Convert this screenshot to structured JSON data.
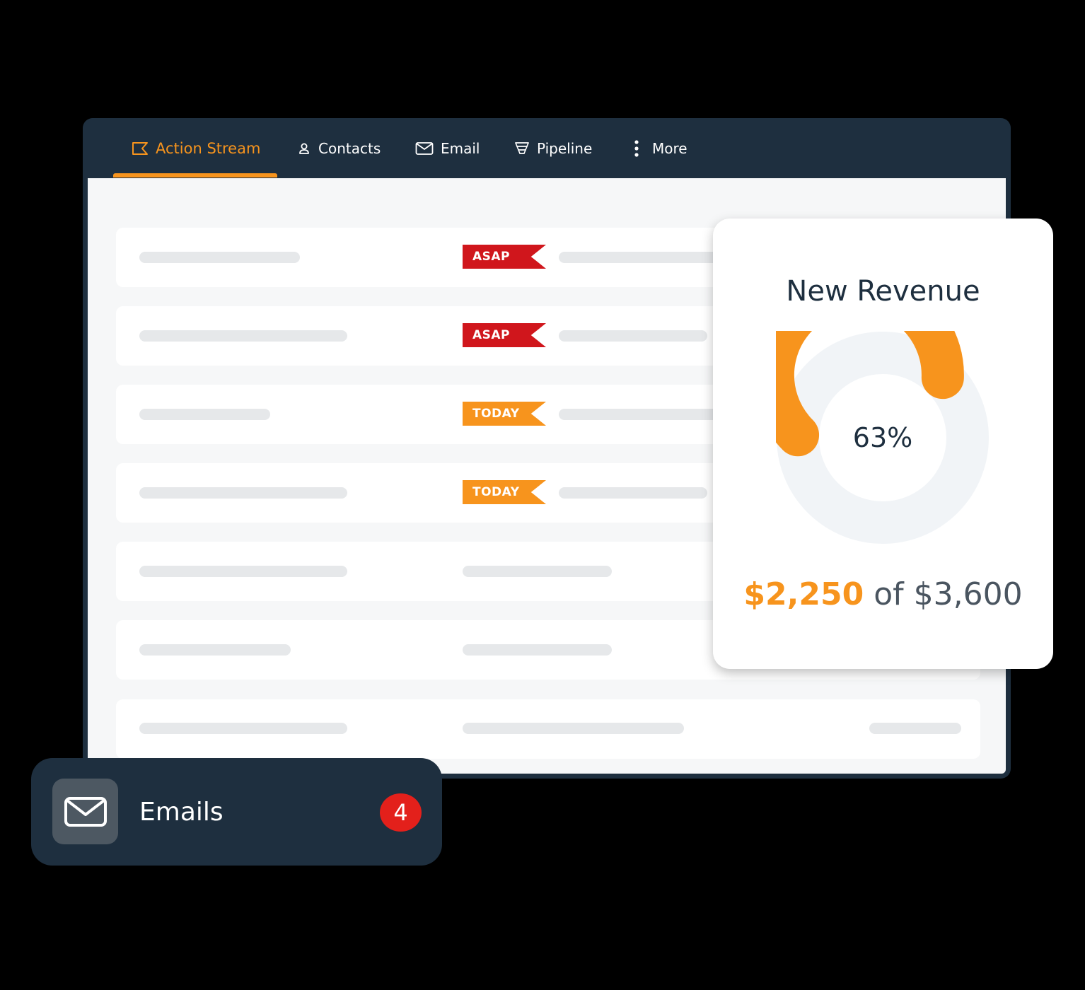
{
  "nav": {
    "items": [
      {
        "label": "Action Stream",
        "icon": "action-stream-icon",
        "active": true
      },
      {
        "label": "Contacts",
        "icon": "person-icon",
        "active": false
      },
      {
        "label": "Email",
        "icon": "envelope-icon",
        "active": false
      },
      {
        "label": "Pipeline",
        "icon": "funnel-icon",
        "active": false
      },
      {
        "label": "More",
        "icon": "vertical-dots-icon",
        "active": false
      }
    ]
  },
  "stream": {
    "rows": [
      {
        "flag": "ASAP",
        "flag_color": "#d0161c"
      },
      {
        "flag": "ASAP",
        "flag_color": "#d0161c"
      },
      {
        "flag": "TODAY",
        "flag_color": "#f7941d"
      },
      {
        "flag": "TODAY",
        "flag_color": "#f7941d"
      },
      {
        "flag": null
      },
      {
        "flag": null
      },
      {
        "flag": null
      }
    ]
  },
  "revenue": {
    "title": "New Revenue",
    "percent_label": "63%",
    "progress": 0.63,
    "current_amount": "$2,250",
    "separator": "of",
    "target_amount": "$3,600"
  },
  "notification": {
    "icon": "envelope-icon",
    "label": "Emails",
    "count": "4"
  },
  "colors": {
    "accent": "#f7941d",
    "navy": "#1e2f3f",
    "alert_red": "#d0161c",
    "badge_red": "#e3201b",
    "track": "#f1f4f7"
  }
}
